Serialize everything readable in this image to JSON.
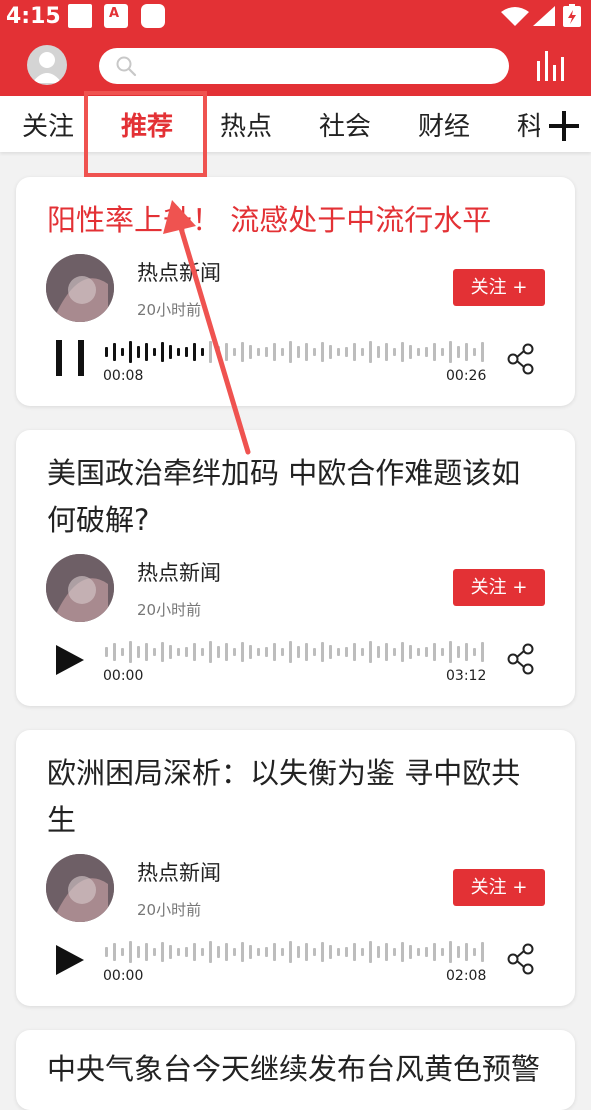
{
  "status_bar": {
    "time": "4:15",
    "notif_icon_label": "A"
  },
  "header": {
    "avatar_icon": "user-avatar-icon",
    "search_icon": "search-icon",
    "stats_icon": "bar-chart-icon"
  },
  "tabs": [
    {
      "label": "关注",
      "active": false
    },
    {
      "label": "推荐",
      "active": true
    },
    {
      "label": "热点",
      "active": false
    },
    {
      "label": "社会",
      "active": false
    },
    {
      "label": "财经",
      "active": false
    },
    {
      "label": "科",
      "active": false
    }
  ],
  "cards": [
    {
      "title": "阳性率上升！ 流感处于中流行水平",
      "source": "热点新闻",
      "time": "20小时前",
      "follow": "关注 +",
      "current": "00:08",
      "duration": "00:26",
      "state": "playing"
    },
    {
      "title": "美国政治牵绊加码 中欧合作难题该如何破解?",
      "source": "热点新闻",
      "time": "20小时前",
      "follow": "关注 +",
      "current": "00:00",
      "duration": "03:12",
      "state": "paused"
    },
    {
      "title": "欧洲困局深析：以失衡为鉴 寻中欧共生",
      "source": "热点新闻",
      "time": "20小时前",
      "follow": "关注 +",
      "current": "00:00",
      "duration": "02:08",
      "state": "paused"
    },
    {
      "title": "中央气象台今天继续发布台风黄色预警"
    }
  ],
  "colors": {
    "accent": "#e33135",
    "annotation": "#ef5350"
  }
}
